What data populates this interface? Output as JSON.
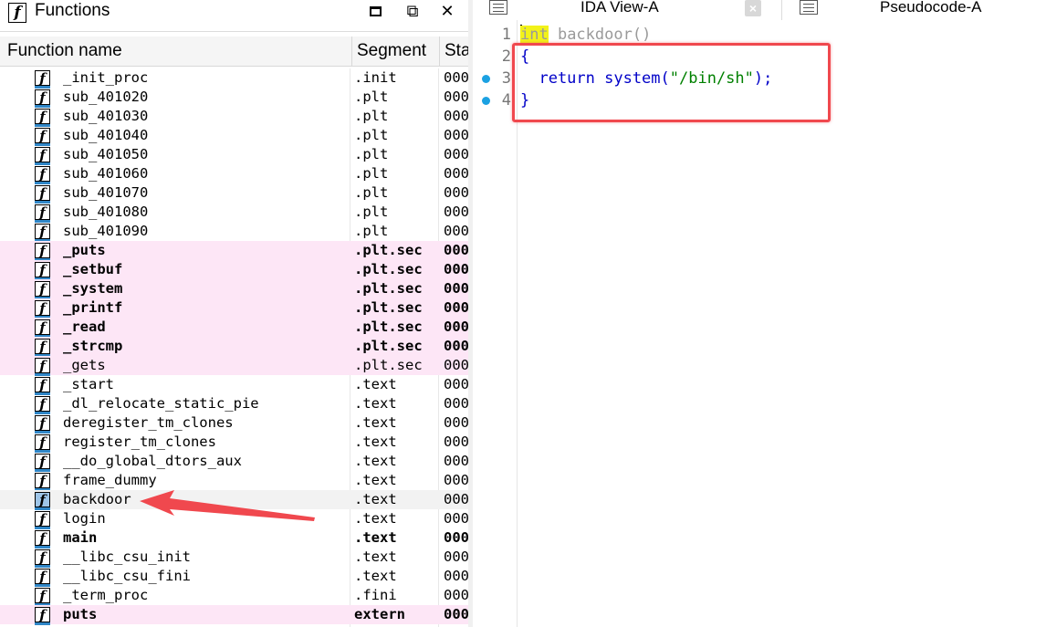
{
  "functions_panel": {
    "title": "Functions",
    "columns": [
      "Function name",
      "Segment",
      "Sta"
    ],
    "rows": [
      {
        "name": "_init_proc",
        "segment": ".init",
        "start": "000",
        "lib": false,
        "bold": false
      },
      {
        "name": "sub_401020",
        "segment": ".plt",
        "start": "000",
        "lib": false,
        "bold": false
      },
      {
        "name": "sub_401030",
        "segment": ".plt",
        "start": "000",
        "lib": false,
        "bold": false
      },
      {
        "name": "sub_401040",
        "segment": ".plt",
        "start": "000",
        "lib": false,
        "bold": false
      },
      {
        "name": "sub_401050",
        "segment": ".plt",
        "start": "000",
        "lib": false,
        "bold": false
      },
      {
        "name": "sub_401060",
        "segment": ".plt",
        "start": "000",
        "lib": false,
        "bold": false
      },
      {
        "name": "sub_401070",
        "segment": ".plt",
        "start": "000",
        "lib": false,
        "bold": false
      },
      {
        "name": "sub_401080",
        "segment": ".plt",
        "start": "000",
        "lib": false,
        "bold": false
      },
      {
        "name": "sub_401090",
        "segment": ".plt",
        "start": "000",
        "lib": false,
        "bold": false
      },
      {
        "name": "_puts",
        "segment": ".plt.sec",
        "start": "000",
        "lib": true,
        "bold": true
      },
      {
        "name": "_setbuf",
        "segment": ".plt.sec",
        "start": "000",
        "lib": true,
        "bold": true
      },
      {
        "name": "_system",
        "segment": ".plt.sec",
        "start": "000",
        "lib": true,
        "bold": true
      },
      {
        "name": "_printf",
        "segment": ".plt.sec",
        "start": "000",
        "lib": true,
        "bold": true
      },
      {
        "name": "_read",
        "segment": ".plt.sec",
        "start": "000",
        "lib": true,
        "bold": true
      },
      {
        "name": "_strcmp",
        "segment": ".plt.sec",
        "start": "000",
        "lib": true,
        "bold": true
      },
      {
        "name": "_gets",
        "segment": ".plt.sec",
        "start": "000",
        "lib": true,
        "bold": false
      },
      {
        "name": "_start",
        "segment": ".text",
        "start": "000",
        "lib": false,
        "bold": false
      },
      {
        "name": "_dl_relocate_static_pie",
        "segment": ".text",
        "start": "000",
        "lib": false,
        "bold": false
      },
      {
        "name": "deregister_tm_clones",
        "segment": ".text",
        "start": "000",
        "lib": false,
        "bold": false
      },
      {
        "name": "register_tm_clones",
        "segment": ".text",
        "start": "000",
        "lib": false,
        "bold": false
      },
      {
        "name": "__do_global_dtors_aux",
        "segment": ".text",
        "start": "000",
        "lib": false,
        "bold": false
      },
      {
        "name": "frame_dummy",
        "segment": ".text",
        "start": "000",
        "lib": false,
        "bold": false
      },
      {
        "name": "backdoor",
        "segment": ".text",
        "start": "000",
        "lib": false,
        "bold": false,
        "selected": true
      },
      {
        "name": "login",
        "segment": ".text",
        "start": "000",
        "lib": false,
        "bold": false
      },
      {
        "name": "main",
        "segment": ".text",
        "start": "000",
        "lib": false,
        "bold": true
      },
      {
        "name": "__libc_csu_init",
        "segment": ".text",
        "start": "000",
        "lib": false,
        "bold": false
      },
      {
        "name": "__libc_csu_fini",
        "segment": ".text",
        "start": "000",
        "lib": false,
        "bold": false
      },
      {
        "name": "_term_proc",
        "segment": ".fini",
        "start": "000",
        "lib": false,
        "bold": false
      },
      {
        "name": "puts",
        "segment": "extern",
        "start": "000",
        "lib": true,
        "bold": true
      }
    ]
  },
  "tabs": {
    "ida_view": "IDA View-A",
    "close_symbol": "×",
    "pseudocode": "Pseudocode-A"
  },
  "code": {
    "lines": [
      {
        "num": "1",
        "type_kw": "int",
        "rest": " backdoor()"
      },
      {
        "num": "2",
        "text": "{"
      },
      {
        "num": "3",
        "pre": "  return system(",
        "string": "\"/bin/sh\"",
        "post": ");"
      },
      {
        "num": "4",
        "text": "}"
      }
    ],
    "breakpoint_dot_color": "#1ba1e2"
  },
  "colors": {
    "library_row": "#fde6f6",
    "annotation_red": "#f0484e",
    "keyword_highlight": "#f2f219",
    "code_blue": "#0000c8"
  },
  "icons": {
    "function": "f",
    "maximize": "maximize-icon",
    "restore": "restore-icon",
    "close": "close-icon"
  },
  "window_buttons": {
    "restore": "⧉",
    "close": "✕"
  }
}
